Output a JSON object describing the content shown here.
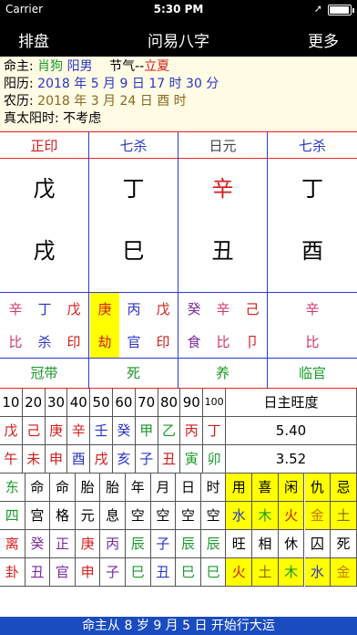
{
  "status": {
    "carrier": "Carrier",
    "time": "5:30 PM",
    "loc": "➚"
  },
  "nav": {
    "left": "排盘",
    "title": "问易八字",
    "right": "更多"
  },
  "info": {
    "r1_label": "命主:",
    "r1_animal": "肖狗",
    "r1_gender": "阳男",
    "r1_term_label": "节气--",
    "r1_term": "立夏",
    "r2_label": "阳历:",
    "r2_value": "2018 年 5 月 9 日 17 时 30 分",
    "r3_label": "农历:",
    "r3_value": "2018 年 3 月 24 日 酉 时",
    "r4_label": "真太阳时:",
    "r4_value": "不考虑"
  },
  "pillars": [
    {
      "god": "正印",
      "stem": "戊",
      "branch": "戌",
      "god_color": "#d41a1a",
      "stem_color": "#000"
    },
    {
      "god": "七杀",
      "stem": "丁",
      "branch": "巳",
      "god_color": "#2a35c8",
      "stem_color": "#000"
    },
    {
      "god": "日元",
      "stem": "辛",
      "branch": "丑",
      "god_color": "#444",
      "stem_color": "#d41a1a"
    },
    {
      "god": "七杀",
      "stem": "丁",
      "branch": "酉",
      "god_color": "#2a35c8",
      "stem_color": "#000"
    }
  ],
  "hidden": [
    [
      [
        "辛",
        "比"
      ],
      [
        "丁",
        "杀"
      ],
      [
        "戊",
        "印"
      ]
    ],
    [
      [
        "庚",
        "劫"
      ],
      [
        "丙",
        "官"
      ],
      [
        "戊",
        "印"
      ]
    ],
    [
      [
        "癸",
        "食"
      ],
      [
        "辛",
        "比"
      ],
      [
        "己",
        "卩"
      ]
    ],
    [
      [
        "",
        ""
      ],
      [
        "辛",
        "比"
      ],
      [
        "",
        ""
      ]
    ]
  ],
  "cycle": [
    "冠带",
    "死",
    "养",
    "临官"
  ],
  "grid": {
    "ages": [
      "10",
      "20",
      "30",
      "40",
      "50",
      "60",
      "70",
      "80",
      "90",
      "100"
    ],
    "strength_label": "日主旺度",
    "stems": [
      "戊",
      "己",
      "庚",
      "辛",
      "壬",
      "癸",
      "甲",
      "乙",
      "丙",
      "丁"
    ],
    "branches": [
      "午",
      "未",
      "申",
      "酉",
      "戌",
      "亥",
      "子",
      "丑",
      "寅",
      "卯"
    ],
    "score1": "5.40",
    "score2": "3.52",
    "row4": [
      "东",
      "命",
      "命",
      "胎",
      "胎",
      "年",
      "月",
      "日",
      "时"
    ],
    "row5": [
      "四",
      "宫",
      "格",
      "元",
      "息",
      "空",
      "空",
      "空",
      "空"
    ],
    "row6": [
      "离",
      "癸",
      "正",
      "庚",
      "丙",
      "辰",
      "子",
      "辰",
      "辰"
    ],
    "row7": [
      "卦",
      "丑",
      "官",
      "申",
      "子",
      "巳",
      "丑",
      "巳",
      "巳"
    ],
    "elem_head": [
      "用",
      "喜",
      "闲",
      "仇",
      "忌"
    ],
    "elem_row1": [
      "水",
      "木",
      "火",
      "金",
      "土"
    ],
    "elem_row2": [
      "旺",
      "相",
      "休",
      "囚",
      "死"
    ],
    "elem_row3": [
      "火",
      "土",
      "木",
      "水",
      "金"
    ]
  },
  "footer": "命主从 8 岁 9 月 5 日 开始行大运"
}
